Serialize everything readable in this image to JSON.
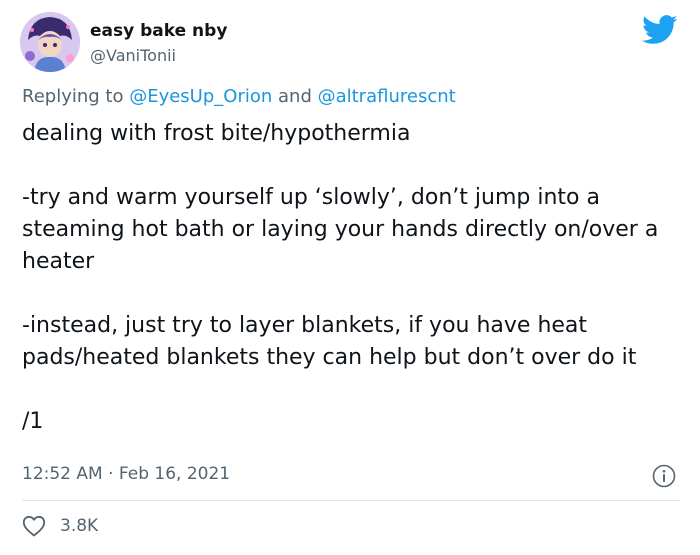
{
  "tweet": {
    "display_name": "easy bake nby",
    "handle": "@VaniTonii",
    "replying_prefix": "Replying to ",
    "reply_mention_1": "@EyesUp_Orion",
    "reply_and": " and ",
    "reply_mention_2": "@altraflurescnt",
    "body": [
      "dealing with frost bite/hypothermia",
      "-try and warm yourself up ‘slowly’, don’t jump into a steaming hot bath or laying your hands directly on/over a heater",
      "-instead, just try to layer blankets, if you have heat pads/heated blankets they can help but don’t over do it",
      "/1"
    ],
    "time": "12:52 AM",
    "separator": " · ",
    "date": "Feb 16, 2021",
    "likes": "3.8K"
  },
  "icons": {
    "logo": "twitter-bird-icon",
    "info": "info-icon",
    "like": "heart-icon"
  },
  "colors": {
    "brand": "#1da1f2",
    "mention": "#1b95e0",
    "secondary_text": "#536471",
    "primary_text": "#0f1419",
    "divider": "#e1e8ed"
  }
}
